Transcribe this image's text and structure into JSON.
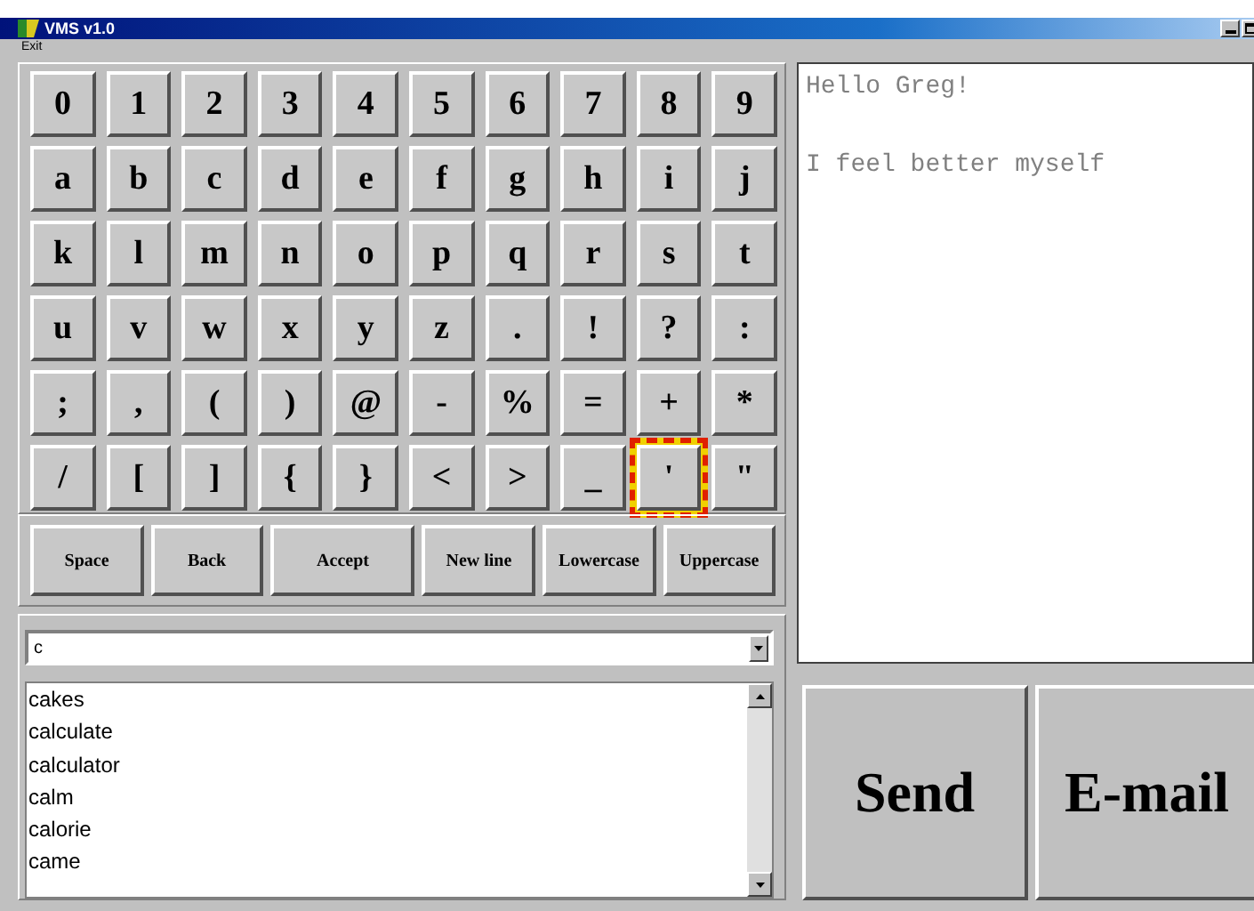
{
  "window": {
    "title": "VMS v1.0"
  },
  "menu": [
    "Exit"
  ],
  "keys": [
    [
      {
        "label": "0",
        "focused": false
      },
      {
        "label": "1",
        "focused": false
      },
      {
        "label": "2",
        "focused": false
      },
      {
        "label": "3",
        "focused": false
      },
      {
        "label": "4",
        "focused": false
      },
      {
        "label": "5",
        "focused": false
      },
      {
        "label": "6",
        "focused": false
      },
      {
        "label": "7",
        "focused": false
      },
      {
        "label": "8",
        "focused": false
      },
      {
        "label": "9",
        "focused": false
      }
    ],
    [
      {
        "label": "a",
        "focused": false
      },
      {
        "label": "b",
        "focused": false
      },
      {
        "label": "c",
        "focused": false
      },
      {
        "label": "d",
        "focused": false
      },
      {
        "label": "e",
        "focused": false
      },
      {
        "label": "f",
        "focused": false
      },
      {
        "label": "g",
        "focused": false
      },
      {
        "label": "h",
        "focused": false
      },
      {
        "label": "i",
        "focused": false
      },
      {
        "label": "j",
        "focused": false
      }
    ],
    [
      {
        "label": "k",
        "focused": false
      },
      {
        "label": "l",
        "focused": false
      },
      {
        "label": "m",
        "focused": false
      },
      {
        "label": "n",
        "focused": false
      },
      {
        "label": "o",
        "focused": false
      },
      {
        "label": "p",
        "focused": false
      },
      {
        "label": "q",
        "focused": false
      },
      {
        "label": "r",
        "focused": false
      },
      {
        "label": "s",
        "focused": false
      },
      {
        "label": "t",
        "focused": false
      }
    ],
    [
      {
        "label": "u",
        "focused": false
      },
      {
        "label": "v",
        "focused": false
      },
      {
        "label": "w",
        "focused": false
      },
      {
        "label": "x",
        "focused": false
      },
      {
        "label": "y",
        "focused": false
      },
      {
        "label": "z",
        "focused": false
      },
      {
        "label": ".",
        "focused": false
      },
      {
        "label": "!",
        "focused": false
      },
      {
        "label": "?",
        "focused": false
      },
      {
        "label": ":",
        "focused": false
      }
    ],
    [
      {
        "label": ";",
        "focused": false
      },
      {
        "label": ",",
        "focused": false
      },
      {
        "label": "(",
        "focused": false
      },
      {
        "label": ")",
        "focused": false
      },
      {
        "label": "@",
        "focused": false
      },
      {
        "label": "-",
        "focused": false
      },
      {
        "label": "%",
        "focused": false
      },
      {
        "label": "=",
        "focused": false
      },
      {
        "label": "+",
        "focused": false
      },
      {
        "label": "*",
        "focused": false
      }
    ],
    [
      {
        "label": "/",
        "focused": false
      },
      {
        "label": "[",
        "focused": false
      },
      {
        "label": "]",
        "focused": false
      },
      {
        "label": "{",
        "focused": false
      },
      {
        "label": "}",
        "focused": false
      },
      {
        "label": "<",
        "focused": false
      },
      {
        "label": ">",
        "focused": false
      },
      {
        "label": "_",
        "focused": false
      },
      {
        "label": "'",
        "focused": true
      },
      {
        "label": "\"",
        "focused": false
      }
    ]
  ],
  "function_keys": [
    "Space",
    "Back",
    "Accept",
    "New line",
    "Lowercase",
    "Uppercase"
  ],
  "word_field": {
    "value": "c"
  },
  "suggestions": [
    "cakes",
    "calculate",
    "calculator",
    "calm",
    "calorie",
    "came"
  ],
  "message": {
    "paragraphs": [
      "Hello Greg!",
      "I feel better myself"
    ]
  },
  "actions": [
    "Send",
    "E-mail"
  ]
}
